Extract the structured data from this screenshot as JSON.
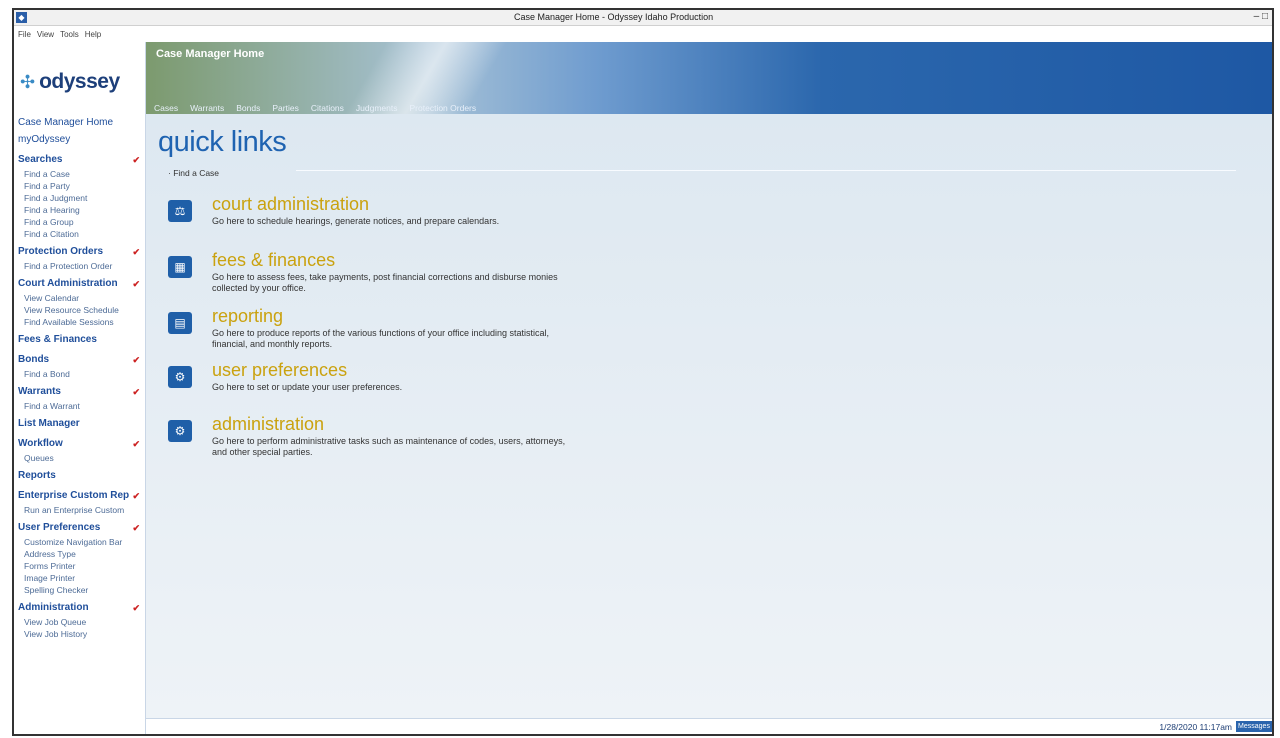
{
  "window": {
    "title": "Case Manager Home - Odyssey Idaho Production",
    "controls": "– □"
  },
  "menubar": [
    "File",
    "View",
    "Tools",
    "Help"
  ],
  "logo": {
    "text": "odyssey",
    "mark": "✣"
  },
  "sidebar": {
    "top_links": [
      "Case Manager Home",
      "myOdyssey"
    ],
    "sections": [
      {
        "label": "Searches",
        "items": [
          "Find a Case",
          "Find a Party",
          "Find a Judgment",
          "Find a Hearing",
          "Find a Group",
          "Find a Citation"
        ]
      },
      {
        "label": "Protection Orders",
        "items": [
          "Find a Protection Order"
        ]
      },
      {
        "label": "Court Administration",
        "items": [
          "View Calendar",
          "View Resource Schedule",
          "Find Available Sessions"
        ]
      },
      {
        "label": "Fees & Finances",
        "items": []
      },
      {
        "label": "Bonds",
        "items": [
          "Find a Bond"
        ]
      },
      {
        "label": "Warrants",
        "items": [
          "Find a Warrant"
        ]
      },
      {
        "label": "List Manager",
        "items": []
      },
      {
        "label": "Workflow",
        "items": [
          "Queues"
        ]
      },
      {
        "label": "Reports",
        "items": []
      },
      {
        "label": "Enterprise Custom Rep",
        "items": [
          "Run an Enterprise Custom"
        ]
      },
      {
        "label": "User Preferences",
        "items": [
          "Customize Navigation Bar",
          "Address Type",
          "Forms Printer",
          "Image Printer",
          "Spelling Checker"
        ]
      },
      {
        "label": "Administration",
        "items": [
          "View Job Queue",
          "View Job History"
        ]
      }
    ]
  },
  "header": {
    "label": "Case Manager Home",
    "tabs": [
      "Cases",
      "Warrants",
      "Bonds",
      "Parties",
      "Citations",
      "Judgments",
      "Protection Orders"
    ]
  },
  "quick_links": {
    "title": "quick links",
    "find_case": "Find a Case",
    "blocks": [
      {
        "head": "court administration",
        "desc": "Go here to schedule hearings, generate notices, and prepare calendars.",
        "icon": "courthouse-icon"
      },
      {
        "head": "fees & finances",
        "desc": "Go here to assess fees, take payments, post financial corrections and disburse monies collected by your office.",
        "icon": "cash-register-icon"
      },
      {
        "head": "reporting",
        "desc": "Go here to produce reports of the various functions of your office including statistical, financial, and monthly reports.",
        "icon": "report-tray-icon"
      },
      {
        "head": "user preferences",
        "desc": "Go here to set or update your user preferences.",
        "icon": "user-gear-icon"
      },
      {
        "head": "administration",
        "desc": "Go here to perform administrative tasks such as maintenance of codes, users, attorneys, and other special parties.",
        "icon": "admin-gear-icon"
      }
    ]
  },
  "status": {
    "datetime": "1/28/2020 11:17am",
    "messages": "Messages"
  },
  "colors": {
    "accent_blue": "#1f63b1",
    "link_head_gold": "#caa20f",
    "chevron_red": "#cc2222"
  }
}
